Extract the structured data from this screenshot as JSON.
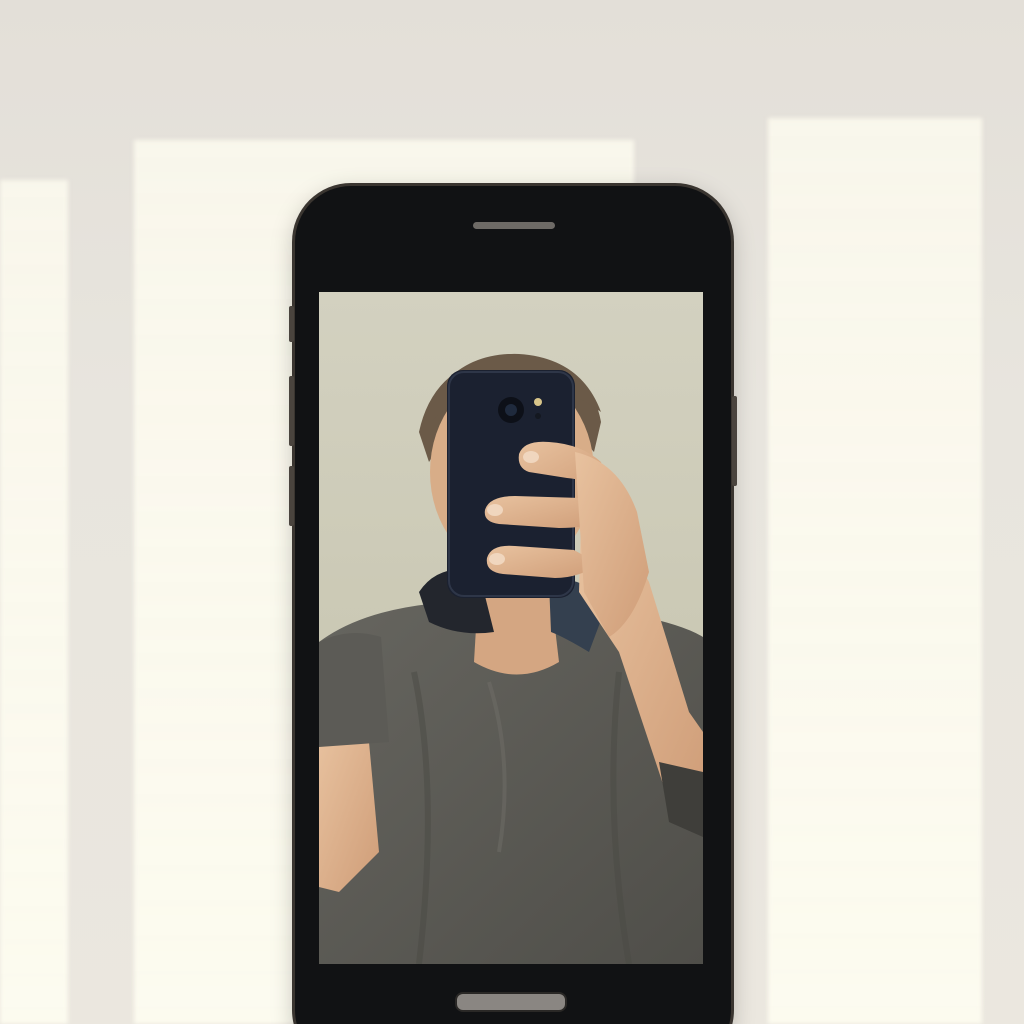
{
  "scene": {
    "description_colors": {
      "wall": "#e6e2da",
      "sunlight": "#fcfaee",
      "phone_body": "#111214",
      "screen_background": "#cfcdb8",
      "shirt": "#5e5d58",
      "held_phone": "#1b2130",
      "skin": "#e0b896",
      "hair": "#6b5a48"
    }
  },
  "phone": {
    "icons": {
      "earpiece": "earpiece-icon",
      "home_button": "home-button-icon",
      "camera": "camera-lens-icon"
    }
  }
}
